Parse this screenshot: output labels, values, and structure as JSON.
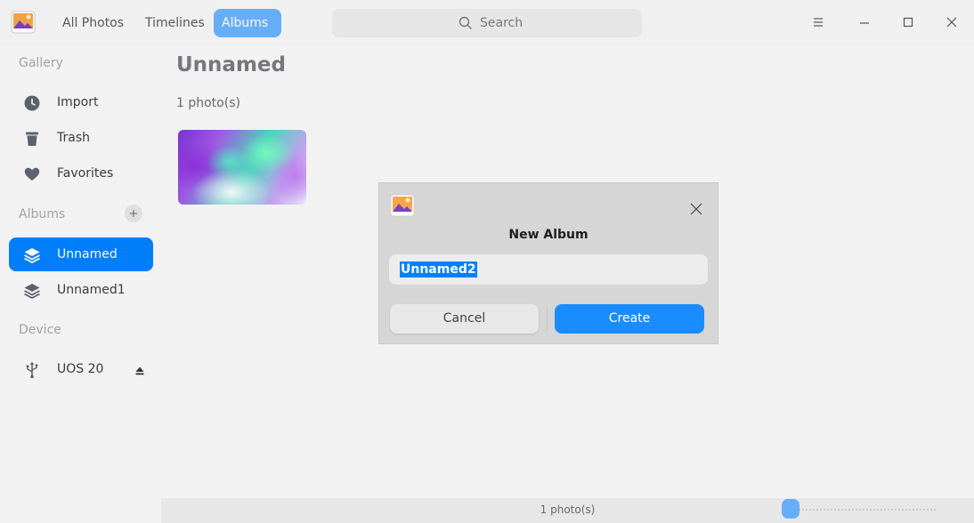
{
  "titlebar": {
    "tabs": [
      {
        "label": "All Photos",
        "active": false
      },
      {
        "label": "Timelines",
        "active": false
      },
      {
        "label": "Albums",
        "active": true
      }
    ],
    "search_placeholder": "Search"
  },
  "sidebar": {
    "gallery_title": "Gallery",
    "gallery_items": [
      {
        "label": "Import",
        "icon": "clock-icon"
      },
      {
        "label": "Trash",
        "icon": "trash-icon"
      },
      {
        "label": "Favorites",
        "icon": "heart-icon"
      }
    ],
    "albums_title": "Albums",
    "album_items": [
      {
        "label": "Unnamed",
        "icon": "album-stack-icon",
        "active": true
      },
      {
        "label": "Unnamed1",
        "icon": "album-stack-icon",
        "active": false
      }
    ],
    "device_title": "Device",
    "device_items": [
      {
        "label": "UOS 20",
        "icon": "usb-icon"
      }
    ]
  },
  "main": {
    "album_title": "Unnamed",
    "photo_count": "1 photo(s)"
  },
  "statusbar": {
    "text": "1 photo(s)"
  },
  "dialog": {
    "title": "New Album",
    "input_value": "Unnamed2",
    "cancel_label": "Cancel",
    "create_label": "Create"
  },
  "colors": {
    "accent": "#0081ff",
    "tab_active": "#6ab2ff"
  }
}
